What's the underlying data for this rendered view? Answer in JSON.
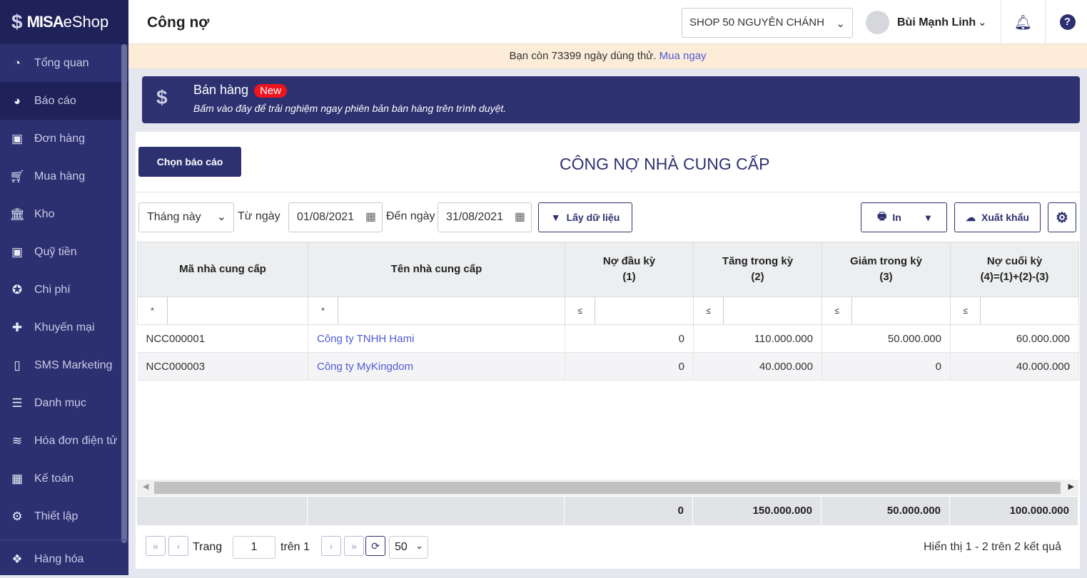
{
  "app": {
    "logo": "MISA eShop",
    "logo_bold": "MISA",
    "logo_light": "eShop"
  },
  "sidebar": {
    "items": [
      {
        "label": "Tổng quan",
        "icon": "dashboard-icon"
      },
      {
        "label": "Báo cáo",
        "icon": "pie-chart-icon"
      },
      {
        "label": "Đơn hàng",
        "icon": "truck-icon"
      },
      {
        "label": "Mua hàng",
        "icon": "cart-icon"
      },
      {
        "label": "Kho",
        "icon": "warehouse-icon"
      },
      {
        "label": "Quỹ tiền",
        "icon": "money-icon"
      },
      {
        "label": "Chi phí",
        "icon": "expense-icon"
      },
      {
        "label": "Khuyến mại",
        "icon": "gift-icon"
      },
      {
        "label": "SMS Marketing",
        "icon": "phone-icon"
      },
      {
        "label": "Danh mục",
        "icon": "list-icon"
      },
      {
        "label": "Hóa đơn điện tử",
        "icon": "invoice-icon"
      },
      {
        "label": "Kế toán",
        "icon": "calculator-icon"
      },
      {
        "label": "Thiết lập",
        "icon": "gear-icon"
      }
    ],
    "bottom": {
      "label": "Hàng hóa",
      "icon": "boxes-icon"
    }
  },
  "header": {
    "title": "Công nợ",
    "shop": "SHOP 50 NGUYÊN CHÁNH",
    "user": "Bùi Mạnh Linh"
  },
  "trial": {
    "text": "Bạn còn 73399 ngày dùng thử.",
    "link": "Mua ngay"
  },
  "banner": {
    "title": "Bán hàng",
    "badge": "New",
    "subtitle": "Bấm vào đây để trải nghiệm ngay phiên bản bán hàng trên trình duyệt."
  },
  "report": {
    "choose_label": "Chọn báo cáo",
    "title": "CÔNG NỢ NHÀ CUNG CẤP"
  },
  "filters": {
    "period": "Tháng này",
    "from_label": "Từ ngày",
    "from": "01/08/2021",
    "to_label": "Đến ngày",
    "to": "31/08/2021",
    "fetch": "Lấy dữ liệu",
    "print": "In",
    "export": "Xuất khẩu"
  },
  "table": {
    "columns": [
      {
        "line1": "Mã nhà cung cấp",
        "line2": "",
        "op": "*"
      },
      {
        "line1": "Tên nhà cung cấp",
        "line2": "",
        "op": "*"
      },
      {
        "line1": "Nợ đầu kỳ",
        "line2": "(1)",
        "op": "≤"
      },
      {
        "line1": "Tăng trong kỳ",
        "line2": "(2)",
        "op": "≤"
      },
      {
        "line1": "Giảm trong kỳ",
        "line2": "(3)",
        "op": "≤"
      },
      {
        "line1": "Nợ cuối kỳ",
        "line2": "(4)=(1)+(2)-(3)",
        "op": "≤"
      }
    ],
    "rows": [
      [
        "NCC000001",
        "Công ty TNHH Hami",
        "0",
        "110.000.000",
        "50.000.000",
        "60.000.000"
      ],
      [
        "NCC000003",
        "Công ty MyKingdom",
        "0",
        "40.000.000",
        "0",
        "40.000.000"
      ]
    ],
    "totals": [
      "",
      "",
      "0",
      "150.000.000",
      "50.000.000",
      "100.000.000"
    ]
  },
  "pagination": {
    "page_label": "Trang",
    "page": "1",
    "of": "trên 1",
    "page_size": "50",
    "summary": "Hiển thị 1 - 2 trên 2 kết quả"
  },
  "colors": {
    "sidebar": "#2c2f70",
    "accent": "#2d3170",
    "link": "#4f5bd5",
    "badge": "#f0141e"
  }
}
